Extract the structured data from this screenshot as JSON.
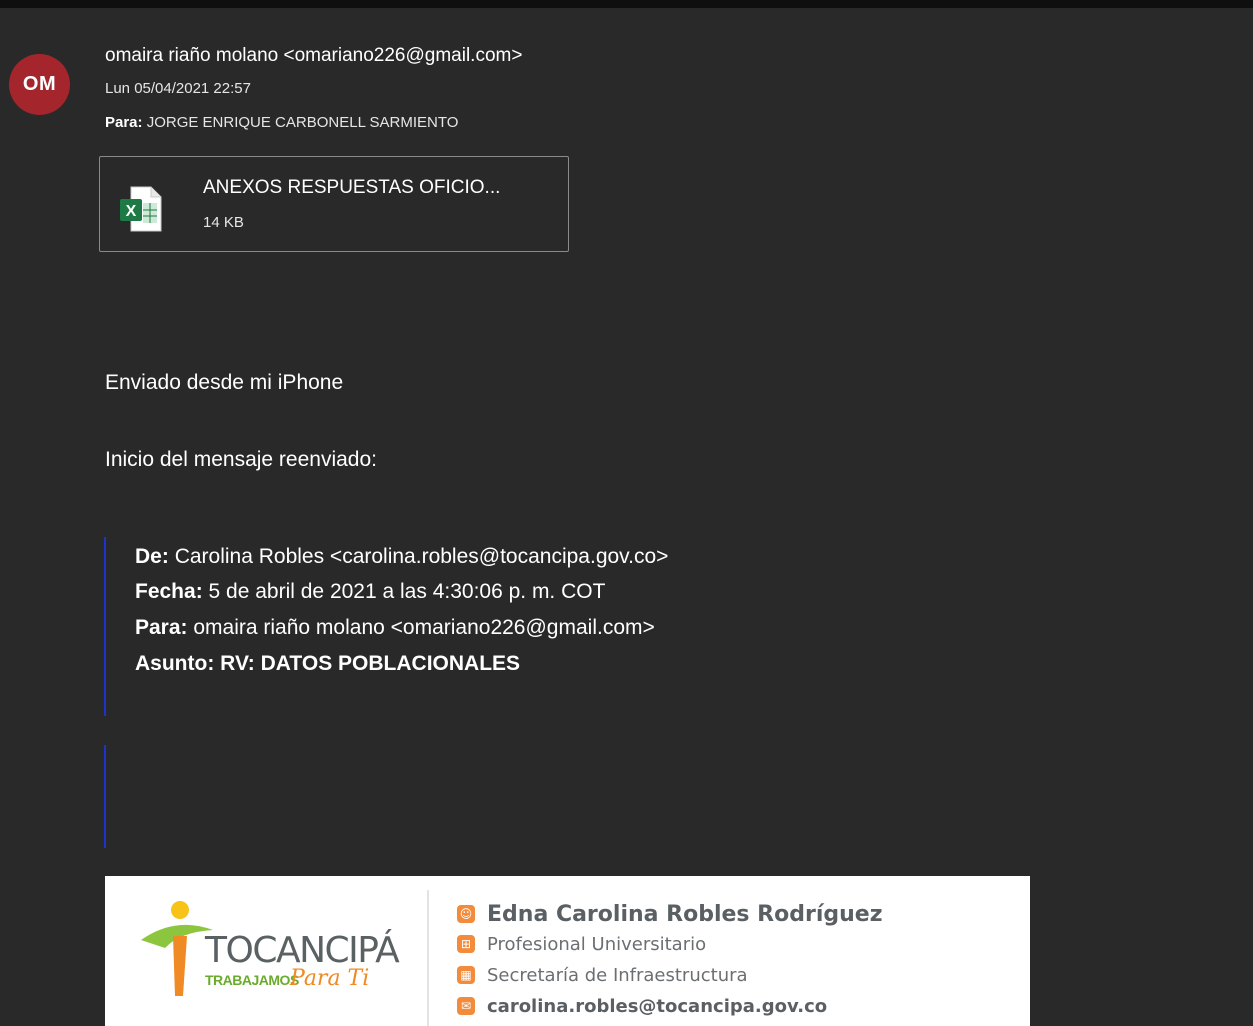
{
  "message": {
    "avatar_initials": "OM",
    "avatar_color": "#a4262c",
    "sender": "omaira riaño molano <omariano226@gmail.com>",
    "date": "Lun 05/04/2021 22:57",
    "to_label": "Para:",
    "to_value": "JORGE ENRIQUE CARBONELL SARMIENTO"
  },
  "attachment": {
    "icon": "excel-file-icon",
    "name": "ANEXOS RESPUESTAS OFICIO...",
    "size": "14 KB"
  },
  "body": {
    "line1": "Enviado desde mi iPhone",
    "line2": "Inicio del mensaje reenviado:"
  },
  "forwarded": {
    "from_label": "De:",
    "from_value": "Carolina Robles <carolina.robles@tocancipa.gov.co>",
    "date_label": "Fecha:",
    "date_value": "5 de abril de 2021 a las 4:30:06 p. m. COT",
    "to_label": "Para:",
    "to_value": "omaira riaño molano <omariano226@gmail.com>",
    "subject_label": "Asunto:",
    "subject_value": "RV: DATOS POBLACIONALES"
  },
  "signature": {
    "logo_word": "TOCANCIPÁ",
    "logo_sub": "TRABAJAMOS",
    "logo_script": "Para Ti",
    "name": "Edna Carolina Robles Rodríguez",
    "role": "Profesional Universitario",
    "department": "Secretaría de Infraestructura",
    "email": "carolina.robles@tocancipa.gov.co",
    "accent_color": "#f28b3c"
  }
}
